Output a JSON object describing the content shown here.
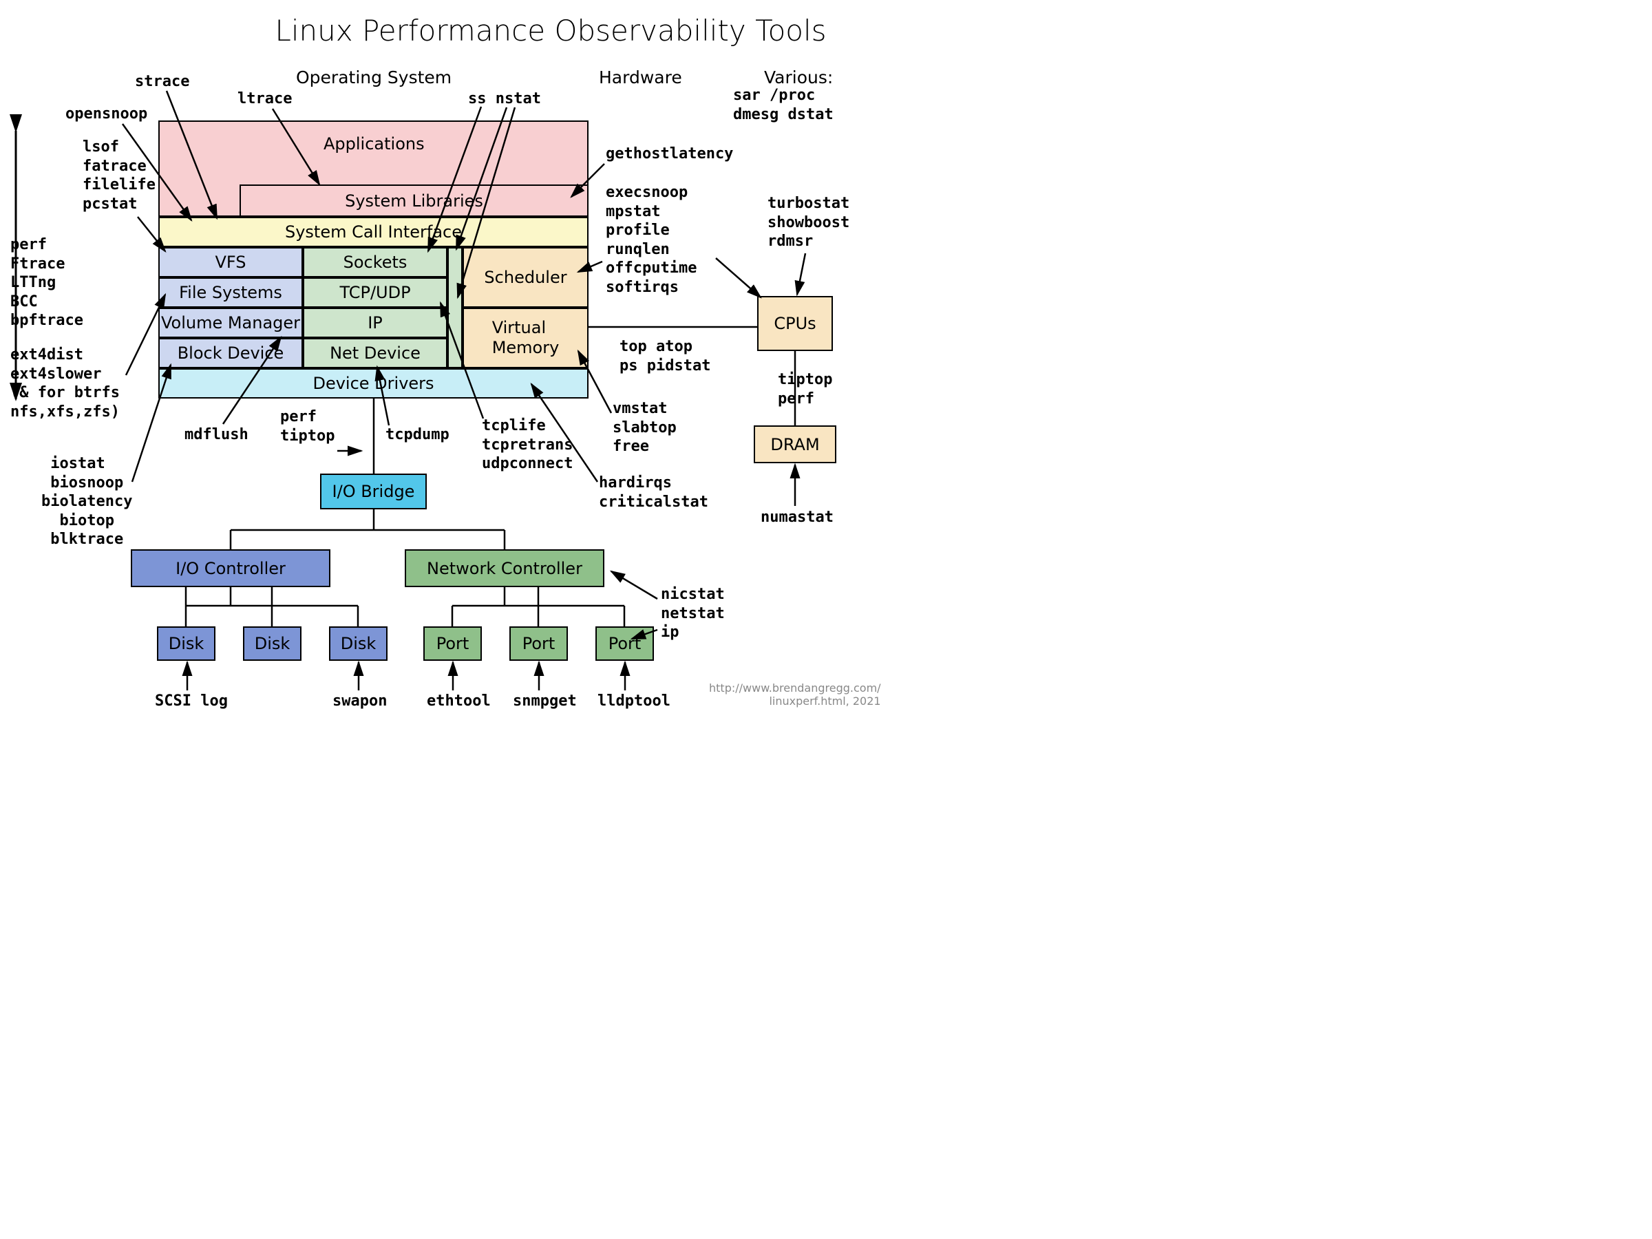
{
  "title": "Linux Performance Observability Tools",
  "section_labels": {
    "os": "Operating System",
    "hw": "Hardware",
    "various": "Various:"
  },
  "os_layers": {
    "applications": "Applications",
    "syslibs": "System Libraries",
    "syscall": "System Call Interface",
    "vfs": "VFS",
    "filesystems": "File Systems",
    "volmgr": "Volume Manager",
    "blockdev": "Block Device",
    "sockets": "Sockets",
    "tcpudp": "TCP/UDP",
    "ip": "IP",
    "netdev": "Net Device",
    "scheduler": "Scheduler",
    "vmem": "Virtual\nMemory",
    "drivers": "Device Drivers"
  },
  "hw_boxes": {
    "cpus": "CPUs",
    "dram": "DRAM",
    "iobridge": "I/O Bridge",
    "ioctrl": "I/O Controller",
    "netctrl": "Network Controller",
    "disk": "Disk",
    "port": "Port"
  },
  "tools": {
    "strace": "strace",
    "ltrace": "ltrace",
    "opensnoop": "opensnoop",
    "ss_nstat": "ss nstat",
    "lsof_group": "lsof\nfatrace\nfilelife\npcstat",
    "perf_group": "perf\nFtrace\nLTTng\nBCC\nbpftrace",
    "ext4_group": "ext4dist\next4slower\n(& for btrfs\nnfs,xfs,zfs)",
    "iostat_group": " iostat\n biosnoop\nbiolatency\n  biotop\n blktrace",
    "mdflush": "mdflush",
    "perf_tiptop": "perf\ntiptop",
    "tcpdump": "tcpdump",
    "tcplife_group": "tcplife\ntcpretrans\nudpconnect",
    "gethostlatency": "gethostlatency",
    "execsnoop_group": "execsnoop\nmpstat\nprofile\nrunqlen\noffcputime\nsoftirqs",
    "top_group": "top atop\nps pidstat",
    "vmstat_group": "vmstat\nslabtop\nfree",
    "hardirqs_group": "hardirqs\ncriticalstat",
    "turbostat_group": "turbostat\nshowboost\nrdmsr",
    "tiptop_perf": "tiptop\nperf",
    "numastat": "numastat",
    "various_tools": "sar /proc\ndmesg dstat",
    "scsilog": "SCSI log",
    "swapon": "swapon",
    "ethtool": "ethtool",
    "snmpget": "snmpget",
    "lldptool": "lldptool",
    "nicstat_group": "nicstat\nnetstat\nip"
  },
  "footer": "http://www.brendangregg.com/\nlinuxperf.html, 2021"
}
